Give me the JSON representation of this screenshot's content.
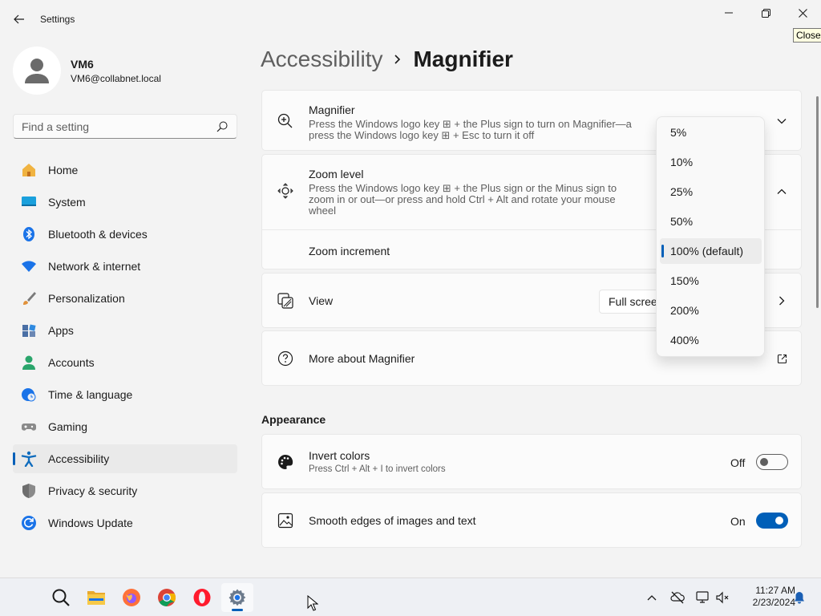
{
  "window": {
    "app_title": "Settings",
    "tooltip": "Close"
  },
  "user": {
    "name": "VM6",
    "email": "VM6@collabnet.local"
  },
  "search": {
    "placeholder": "Find a setting"
  },
  "sidebar": {
    "items": [
      {
        "label": "Home",
        "icon": "home-icon",
        "color": "#e8a33d"
      },
      {
        "label": "System",
        "icon": "system-icon",
        "color": "#0f8fd6"
      },
      {
        "label": "Bluetooth & devices",
        "icon": "bluetooth-icon",
        "color": "#1a73e8"
      },
      {
        "label": "Network & internet",
        "icon": "wifi-icon",
        "color": "#1a73e8"
      },
      {
        "label": "Personalization",
        "icon": "brush-icon",
        "color": "#d08a3a"
      },
      {
        "label": "Apps",
        "icon": "apps-icon",
        "color": "#4a6fa5"
      },
      {
        "label": "Accounts",
        "icon": "accounts-icon",
        "color": "#2aa56b"
      },
      {
        "label": "Time & language",
        "icon": "globe-clock-icon",
        "color": "#1a73e8"
      },
      {
        "label": "Gaming",
        "icon": "gamepad-icon",
        "color": "#8a8a8a"
      },
      {
        "label": "Accessibility",
        "icon": "accessibility-icon",
        "color": "#0f6cbd"
      },
      {
        "label": "Privacy & security",
        "icon": "shield-icon",
        "color": "#7a7a7a"
      },
      {
        "label": "Windows Update",
        "icon": "update-icon",
        "color": "#1a73e8"
      }
    ],
    "active_index": 9
  },
  "breadcrumb": {
    "parent": "Accessibility",
    "current": "Magnifier"
  },
  "magnifier": {
    "title": "Magnifier",
    "desc_line1": "Press the Windows logo key ⊞ + the Plus sign to turn on Magnifier—a",
    "desc_line2": "press the Windows logo key ⊞ + Esc to turn it off"
  },
  "zoom_level": {
    "title": "Zoom level",
    "desc_line1": "Press the Windows logo key ⊞ + the Plus sign or the Minus sign to",
    "desc_line2": "zoom in or out—or press and hold Ctrl + Alt and rotate your mouse",
    "desc_line3": "wheel",
    "increment_label": "Zoom increment"
  },
  "view": {
    "title": "View",
    "selected": "Full scree"
  },
  "more": {
    "title": "More about Magnifier"
  },
  "appearance": {
    "section_title": "Appearance",
    "invert": {
      "title": "Invert colors",
      "desc": "Press Ctrl + Alt + I to invert colors",
      "state": "Off"
    },
    "smooth": {
      "title": "Smooth edges of images and text",
      "state": "On"
    }
  },
  "zoom_dropdown": {
    "options": [
      "5%",
      "10%",
      "25%",
      "50%",
      "100% (default)",
      "150%",
      "200%",
      "400%"
    ],
    "selected_index": 4
  },
  "taskbar": {
    "apps": [
      "search-icon",
      "file-explorer-icon",
      "firefox-icon",
      "chrome-icon",
      "opera-icon",
      "settings-icon"
    ],
    "time": "11:27 AM",
    "date": "2/23/2024"
  },
  "colors": {
    "accent": "#005fb8"
  }
}
